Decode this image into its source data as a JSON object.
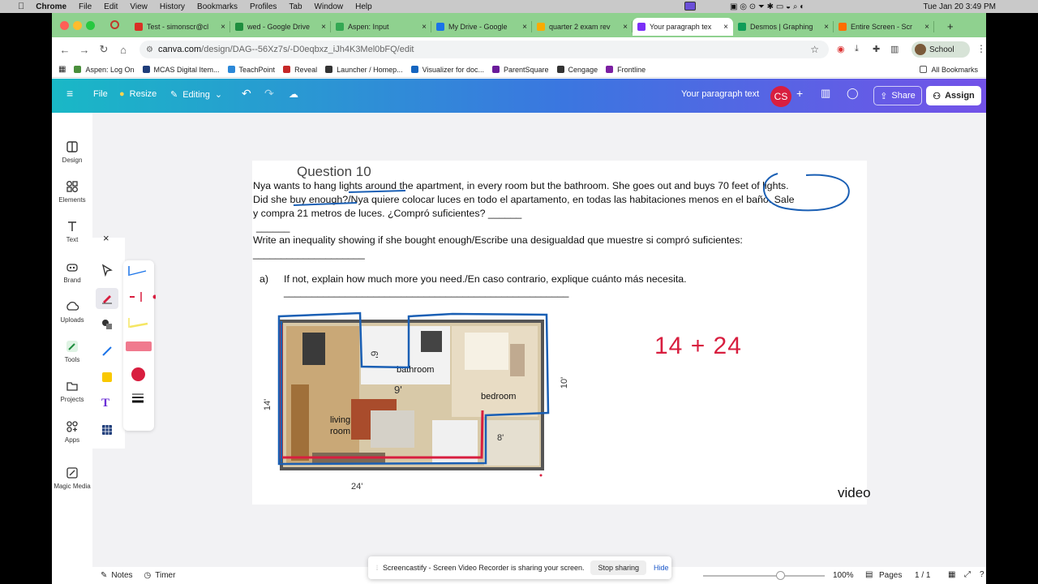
{
  "mac_menu": {
    "app": "Chrome",
    "items": [
      "File",
      "Edit",
      "View",
      "History",
      "Bookmarks",
      "Profiles",
      "Tab",
      "Window",
      "Help"
    ],
    "clock": "Tue Jan 20  3:49 PM"
  },
  "tabs": [
    {
      "label": "Test - simonscr@cl",
      "color": "#d93025"
    },
    {
      "label": "wed - Google Drive",
      "color": "#1e8e3e"
    },
    {
      "label": "Aspen: Input",
      "color": "#34a853"
    },
    {
      "label": "My Drive - Google",
      "color": "#1a73e8"
    },
    {
      "label": "quarter 2 exam rev",
      "color": "#f9ab00"
    },
    {
      "label": "Your paragraph tex",
      "color": "#7b2ff7",
      "active": true
    },
    {
      "label": "Desmos | Graphing",
      "color": "#0f9d58"
    },
    {
      "label": "Entire Screen - Scr",
      "color": "#ff6d00"
    }
  ],
  "address": {
    "host": "canva.com",
    "path": "/design/DAG--56Xz7s/-D0eqbxz_iJh4K3Mel0bFQ/edit",
    "profile_label": "School"
  },
  "bookmarks": [
    "Aspen: Log On",
    "MCAS Digital Item...",
    "TeachPoint",
    "Reveal",
    "Launcher / Homep...",
    "Visualizer for doc...",
    "ParentSquare",
    "Cengage",
    "Frontline"
  ],
  "all_bookmarks": "All Bookmarks",
  "canva_header": {
    "file": "File",
    "resize": "Resize",
    "editing": "Editing",
    "doc_title": "Your paragraph text",
    "avatar": "CS",
    "share": "Share",
    "assign": "Assign"
  },
  "rail": [
    "Design",
    "Elements",
    "Text",
    "Brand",
    "Uploads",
    "Tools",
    "Projects",
    "Apps",
    "Magic Media"
  ],
  "page": {
    "question": "Question 10",
    "line1": "Nya wants to hang lights around the apartment, in every room but the bathroom. She goes out and buys 70 feet of lights.",
    "line2": "Did she buy enough?/Nya quiere colocar luces en todo el apartamento, en todas las habitaciones menos en el baño. Sale",
    "line3": "y compra 21 metros de luces. ¿Compró suficientes? ______",
    "line4": "______",
    "line5": "Write an inequality showing if she bought enough/Escribe una desigualdad que muestre si compró suficientes:",
    "line6": "____________________",
    "part_a_label": "a)",
    "part_a": "If not, explain how much more you need./En caso contrario, explique cuánto más necesita.",
    "part_a_blank": "___________________________________________________",
    "floorplan": {
      "bathroom": "bathroom",
      "bedroom": "bedroom",
      "living_room": "living\nroom",
      "dim_6": "6'",
      "dim_9": "9'",
      "dim_10": "10'",
      "dim_14": "14'",
      "dim_8": "8'",
      "dim_24": "24'"
    },
    "handwriting": "14 + 24",
    "video_label": "video"
  },
  "bottom": {
    "notes": "Notes",
    "timer": "Timer",
    "zoom": "100%",
    "pages": "Pages",
    "page_count": "1 / 1"
  },
  "castify": {
    "message": "Screencastify - Screen Video Recorder is sharing your screen.",
    "stop": "Stop sharing",
    "hide": "Hide"
  }
}
